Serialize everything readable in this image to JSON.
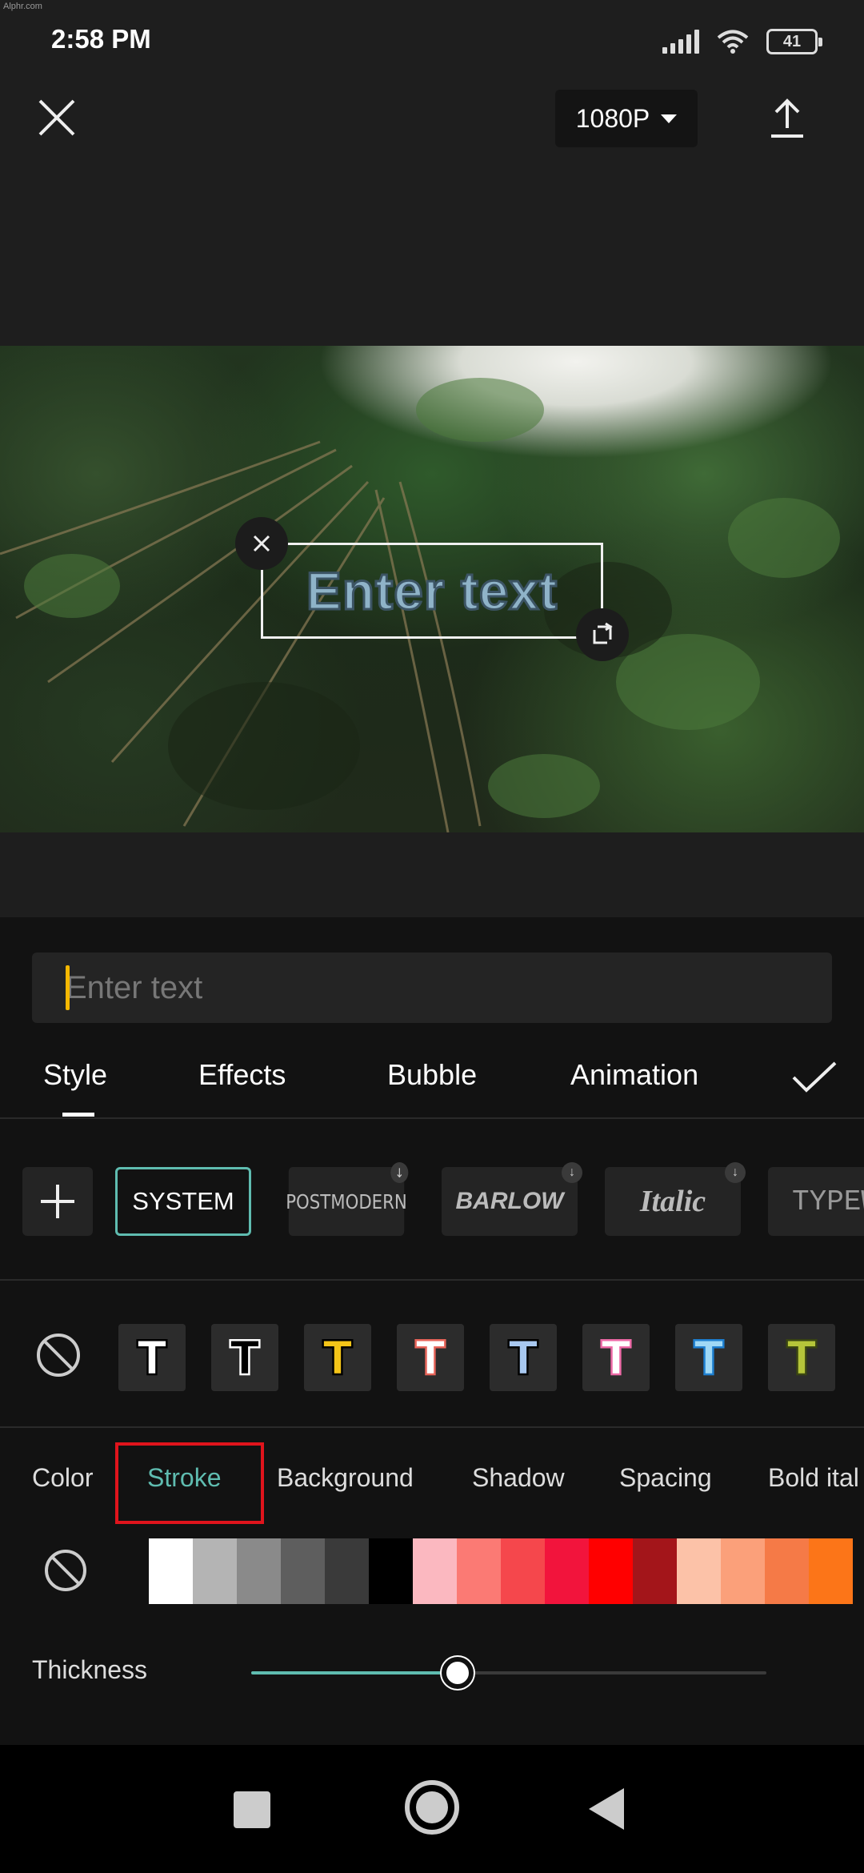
{
  "status_bar": {
    "watermark": "Alphr.com",
    "time": "2:58 PM",
    "battery": "41"
  },
  "top_bar": {
    "resolution": "1080P",
    "icons": [
      "close-icon",
      "chevron-down-icon",
      "export-icon"
    ]
  },
  "preview": {
    "overlay_text": "Enter text"
  },
  "editor": {
    "input_placeholder": "Enter text",
    "tabs": [
      {
        "label": "Style",
        "active": true
      },
      {
        "label": "Effects",
        "active": false
      },
      {
        "label": "Bubble",
        "active": false
      },
      {
        "label": "Animation",
        "active": false
      }
    ],
    "fonts": [
      {
        "label": "SYSTEM",
        "selected": true
      },
      {
        "label": "POSTMODERN",
        "selected": false
      },
      {
        "label": "BARLOW",
        "selected": false
      },
      {
        "label": "Italic",
        "selected": false
      },
      {
        "label": "TYPEW",
        "selected": false
      }
    ],
    "text_styles": [
      {
        "fill": "#ffffff",
        "stroke": "#000000"
      },
      {
        "fill": "#000000",
        "stroke": "#ffffff"
      },
      {
        "fill": "#f5c518",
        "stroke": "#000000"
      },
      {
        "fill": "#ffffff",
        "stroke": "#e8655a"
      },
      {
        "fill": "#a8c8f0",
        "stroke": "#000000"
      },
      {
        "fill": "#ffffff",
        "stroke": "#ee6aa7"
      },
      {
        "fill": "#9fd8f5",
        "stroke": "#1e7fd0"
      },
      {
        "fill": "#b5c53a",
        "stroke": "#3a4512"
      }
    ],
    "subtabs": [
      {
        "label": "Color",
        "active": false
      },
      {
        "label": "Stroke",
        "active": true
      },
      {
        "label": "Background",
        "active": false
      },
      {
        "label": "Shadow",
        "active": false
      },
      {
        "label": "Spacing",
        "active": false
      },
      {
        "label": "Bold ital",
        "active": false
      }
    ],
    "colors": [
      "#ffffff",
      "#b4b4b4",
      "#8a8a8a",
      "#5e5e5e",
      "#3a3a3a",
      "#000000",
      "#fbb8c0",
      "#fb7a74",
      "#f5474c",
      "#f2143c",
      "#ff0000",
      "#a3151a",
      "#fcc2a8",
      "#fba07a",
      "#f57a47",
      "#fc7518"
    ],
    "thickness": {
      "label": "Thickness",
      "value": 0.4
    },
    "accent_color": "#5fbcb0",
    "highlight_color": "#e0141c"
  },
  "nav_bar": {
    "icons": [
      "recents-icon",
      "home-icon",
      "back-icon"
    ]
  }
}
